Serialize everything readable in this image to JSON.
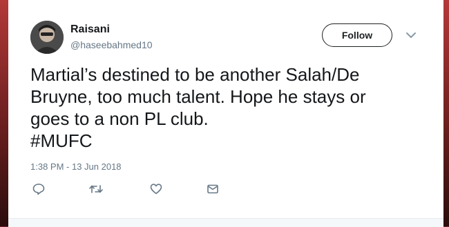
{
  "tweet": {
    "author_name": "Raisani",
    "author_handle": "@haseebahmed10",
    "follow_label": "Follow",
    "text": "Martial’s destined to be another Salah/De\nBruyne, too much talent. Hope he stays or\ngoes to a non PL club.\n#MUFC",
    "timestamp": "1:38 PM - 13 Jun 2018"
  },
  "icons": {
    "reply": "reply-icon",
    "retweet": "retweet-icon",
    "like": "heart-icon",
    "message": "envelope-icon",
    "menu": "chevron-down-icon"
  },
  "colors": {
    "text": "#14171a",
    "secondary": "#657786",
    "background_accent": "#7a2a2a"
  }
}
